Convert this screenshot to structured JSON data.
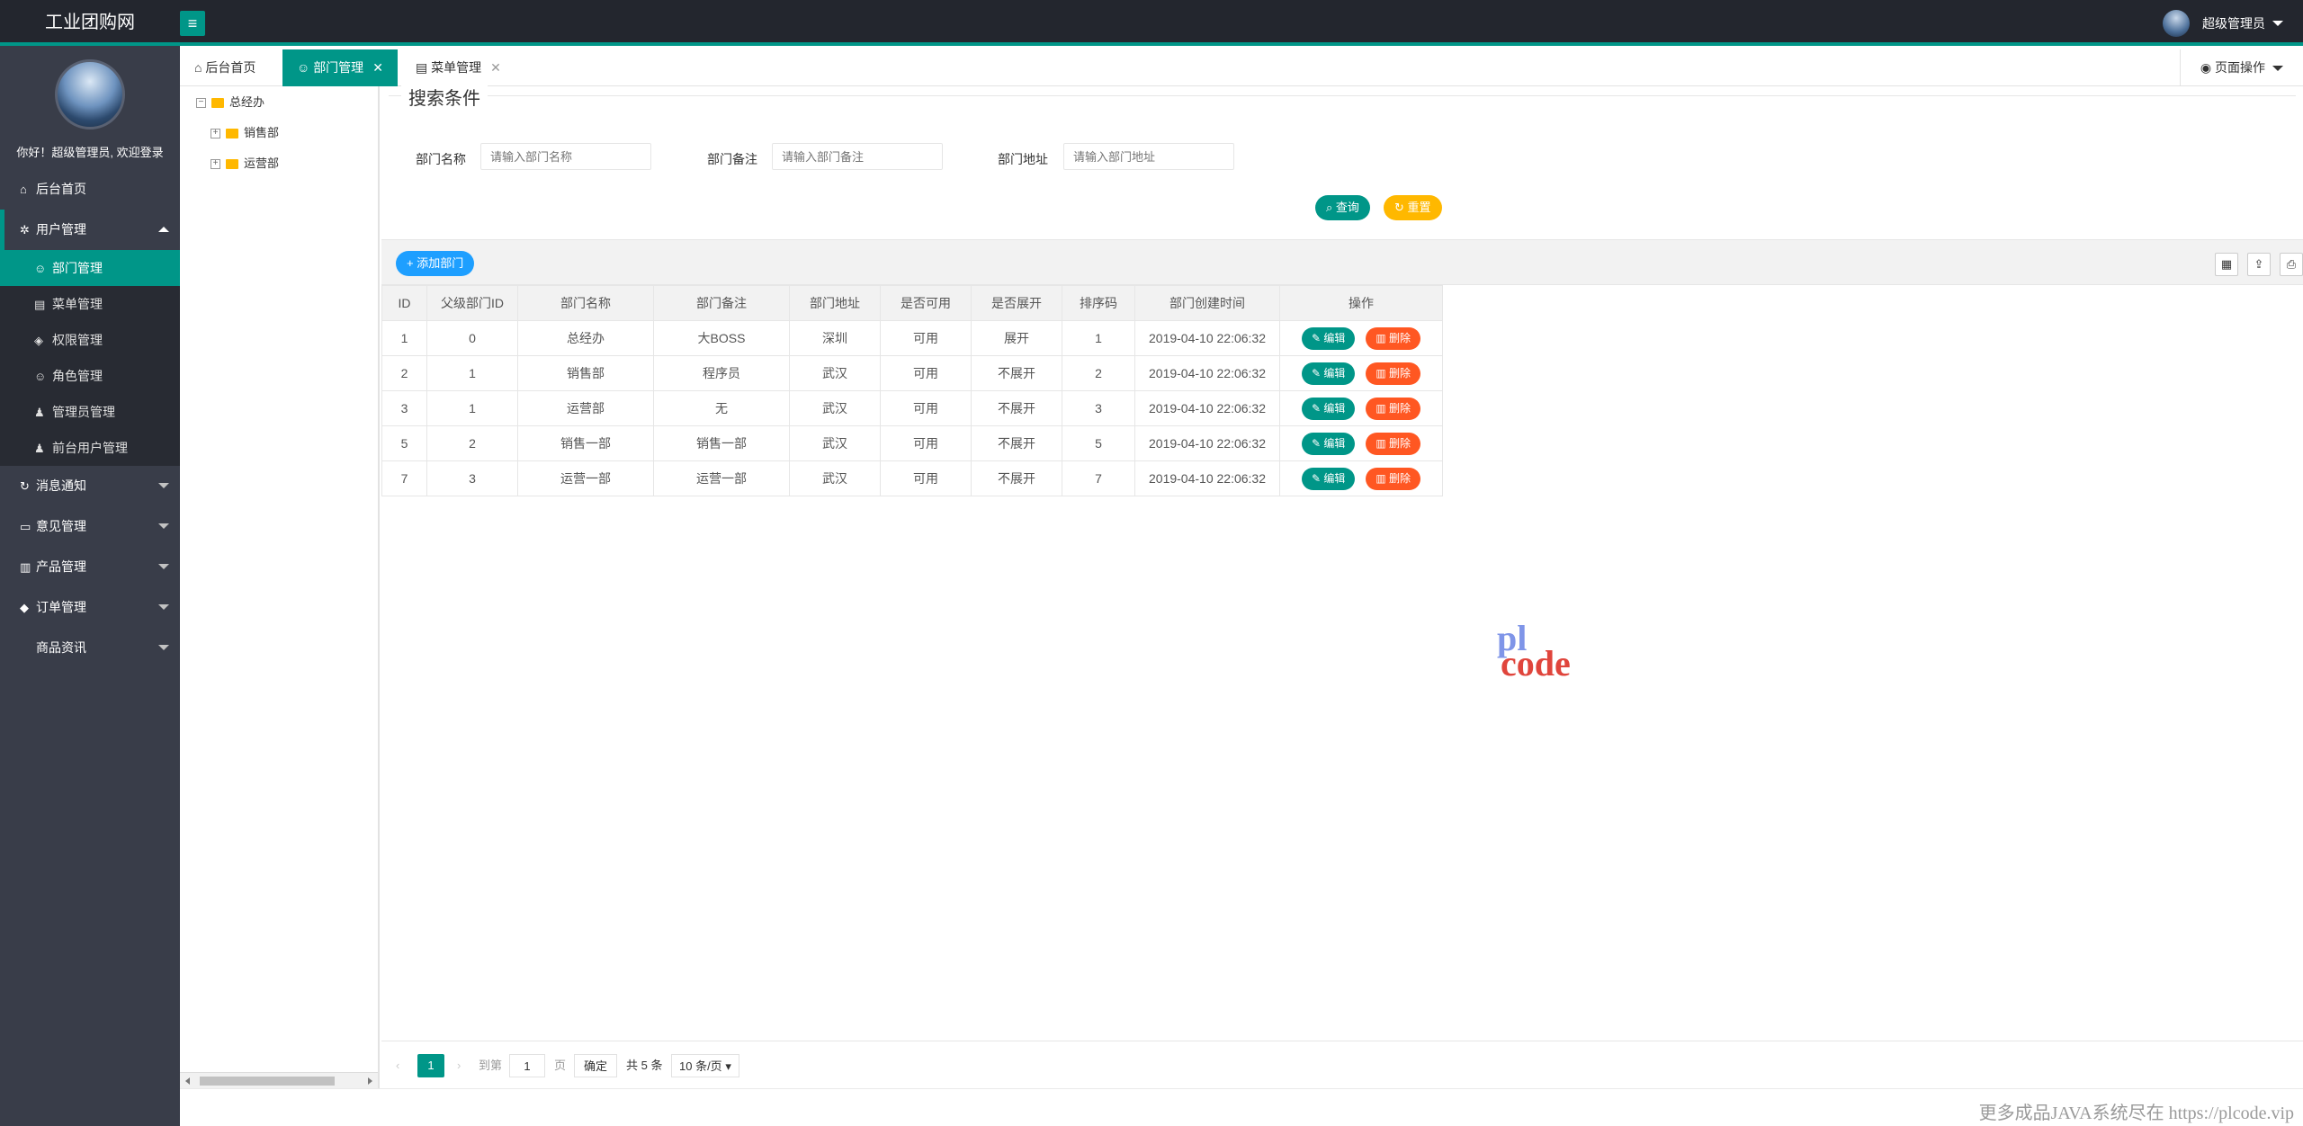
{
  "app": {
    "title": "工业团购网"
  },
  "topbar": {
    "user_name": "超级管理员"
  },
  "sidebar": {
    "welcome": "你好！超级管理员, 欢迎登录",
    "home": "后台首页",
    "user_mgmt": "用户管理",
    "sub": [
      "部门管理",
      "菜单管理",
      "权限管理",
      "角色管理",
      "管理员管理",
      "前台用户管理"
    ],
    "msg": "消息通知",
    "opinion": "意见管理",
    "product": "产品管理",
    "order": "订单管理",
    "goods": "商品资讯"
  },
  "tabs": {
    "home": "后台首页",
    "dept": "部门管理",
    "menu": "菜单管理",
    "page_ops": "页面操作"
  },
  "tree": {
    "root": "总经办",
    "child1": "销售部",
    "child2": "运营部"
  },
  "search": {
    "legend": "搜索条件",
    "name_label": "部门名称",
    "name_ph": "请输入部门名称",
    "remark_label": "部门备注",
    "remark_ph": "请输入部门备注",
    "addr_label": "部门地址",
    "addr_ph": "请输入部门地址",
    "query": "查询",
    "reset": "重置"
  },
  "grid": {
    "add_label": "添加部门",
    "columns": [
      "ID",
      "父级部门ID",
      "部门名称",
      "部门备注",
      "部门地址",
      "是否可用",
      "是否展开",
      "排序码",
      "部门创建时间",
      "操作"
    ],
    "edit": "编辑",
    "del": "删除",
    "rows": [
      [
        "1",
        "0",
        "总经办",
        "大BOSS",
        "深圳",
        "可用",
        "展开",
        "1",
        "2019-04-10 22:06:32"
      ],
      [
        "2",
        "1",
        "销售部",
        "程序员",
        "武汉",
        "可用",
        "不展开",
        "2",
        "2019-04-10 22:06:32"
      ],
      [
        "3",
        "1",
        "运营部",
        "无",
        "武汉",
        "可用",
        "不展开",
        "3",
        "2019-04-10 22:06:32"
      ],
      [
        "5",
        "2",
        "销售一部",
        "销售一部",
        "武汉",
        "可用",
        "不展开",
        "5",
        "2019-04-10 22:06:32"
      ],
      [
        "7",
        "3",
        "运营一部",
        "运营一部",
        "武汉",
        "可用",
        "不展开",
        "7",
        "2019-04-10 22:06:32"
      ]
    ]
  },
  "watermark": {
    "line1": "pl",
    "line2": "code"
  },
  "pager": {
    "current": "1",
    "goto": "到第",
    "page_value": "1",
    "page_unit": "页",
    "ok": "确定",
    "total": "共 5 条",
    "size": "10 条/页"
  },
  "footer": {
    "text": "更多成品JAVA系统尽在 https://plcode.vip"
  }
}
